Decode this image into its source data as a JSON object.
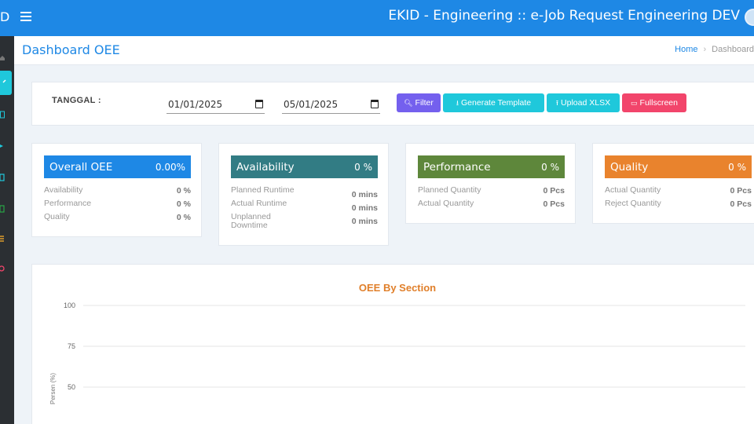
{
  "header": {
    "brand": "D",
    "title": "EKID - Engineering :: e-Job Request Engineering DEV"
  },
  "page": {
    "title": "Dashboard OEE",
    "breadcrumb": {
      "home": "Home",
      "current": "Dashboard"
    }
  },
  "filter": {
    "label": "TANGGAL :",
    "date_from": "01/01/2025",
    "date_to": "05/01/2025",
    "buttons": {
      "filter": "Filter",
      "generate": "Generate Template",
      "upload": "Upload XLSX",
      "fullscreen": "Fullscreen"
    }
  },
  "cards": [
    {
      "name": "Overall OEE",
      "value": "0.00%",
      "color": "#1e88e5",
      "rows": [
        {
          "label": "Availability",
          "value": "0 %"
        },
        {
          "label": "Performance",
          "value": "0 %"
        },
        {
          "label": "Quality",
          "value": "0 %"
        }
      ]
    },
    {
      "name": "Availability",
      "value": "0 %",
      "color": "#327c84",
      "rows": [
        {
          "label": "Planned Runtime",
          "value": "0 mins"
        },
        {
          "label": "Actual Runtime",
          "value": "0 mins"
        },
        {
          "label": "Unplanned Downtime",
          "value": "0 mins"
        }
      ]
    },
    {
      "name": "Performance",
      "value": "0 %",
      "color": "#5e873b",
      "rows": [
        {
          "label": "Planned Quantity",
          "value": "0 Pcs"
        },
        {
          "label": "Actual Quantity",
          "value": "0 Pcs"
        }
      ]
    },
    {
      "name": "Quality",
      "value": "0 %",
      "color": "#e9832d",
      "rows": [
        {
          "label": "Actual Quantity",
          "value": "0 Pcs"
        },
        {
          "label": "Reject Quantity",
          "value": "0 Pcs"
        }
      ]
    }
  ],
  "chart_data": {
    "type": "bar",
    "title": "OEE By Section",
    "ylabel": "Persen (%)",
    "yticks": [
      100,
      75,
      50
    ],
    "ylim": [
      0,
      100
    ],
    "categories": [],
    "series": []
  },
  "colors": {
    "primary": "#1e88e5",
    "filter_btn": "#7460ee",
    "info_btn": "#1fc8db",
    "danger_btn": "#f2456b",
    "sidebar": "#2b2f33"
  }
}
